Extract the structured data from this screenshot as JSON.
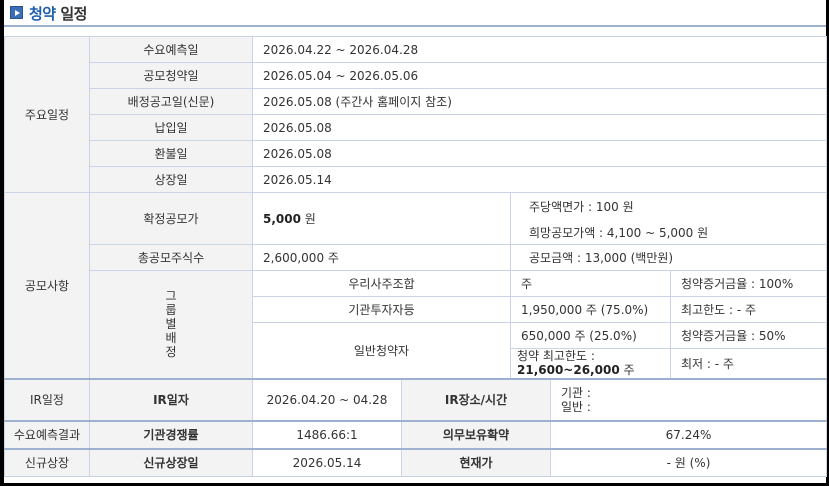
{
  "title": {
    "accent": "청약",
    "rest": "일정"
  },
  "schedule": {
    "section": "주요일정",
    "rows": [
      {
        "label": "수요예측일",
        "value": "2026.04.22  ~  2026.04.28"
      },
      {
        "label": "공모청약일",
        "value": "2026.05.04  ~  2026.05.06"
      },
      {
        "label": "배정공고일(신문)",
        "value": "2026.05.08 (주간사 홈페이지 참조)"
      },
      {
        "label": "납입일",
        "value": "2026.05.08"
      },
      {
        "label": "환불일",
        "value": "2026.05.08"
      },
      {
        "label": "상장일",
        "value": "2026.05.14"
      }
    ]
  },
  "offering": {
    "section": "공모사항",
    "price_label": "확정공모가",
    "price_value": "5,000",
    "price_unit": " 원",
    "par_value": "주당액면가 :  100 원",
    "desired_price": "희망공모가액 :  4,100 ~ 5,000 원",
    "total_shares_label": "총공모주식수",
    "total_shares_value": "2,600,000 주",
    "total_amount": "공모금액 : 13,000 (백만원)",
    "group_label": "그룹별배정",
    "groups": [
      {
        "name": "우리사주조합",
        "shares": "주",
        "note": "청약증거금율 : 100%"
      },
      {
        "name": "기관투자자등",
        "shares": "1,950,000 주  (75.0%)",
        "note": "최고한도 :  - 주"
      },
      {
        "name": "일반청약자",
        "shares": "650,000 주  (25.0%)",
        "note": "청약증거금율 : 50%",
        "limit_label": "청약 최고한도 :",
        "limit_value": "21,600~26,000",
        "limit_unit": " 주",
        "min_note": "최저 :  - 주"
      }
    ]
  },
  "ir": {
    "section": "IR일정",
    "date_label": "IR일자",
    "date_value": "2026.04.20 ~ 04.28",
    "place_label": "IR장소/시간",
    "place_inst": "기관 :",
    "place_general": "일반 :"
  },
  "demand": {
    "section": "수요예측결과",
    "competition_label": "기관경쟁률",
    "competition_value": "1486.66:1",
    "lockup_label": "의무보유확약",
    "lockup_value": "67.24%"
  },
  "listing": {
    "section": "신규상장",
    "date_label": "신규상장일",
    "date_value": "2026.05.14",
    "price_label": "현재가",
    "price_value": "- 원 (%)"
  }
}
